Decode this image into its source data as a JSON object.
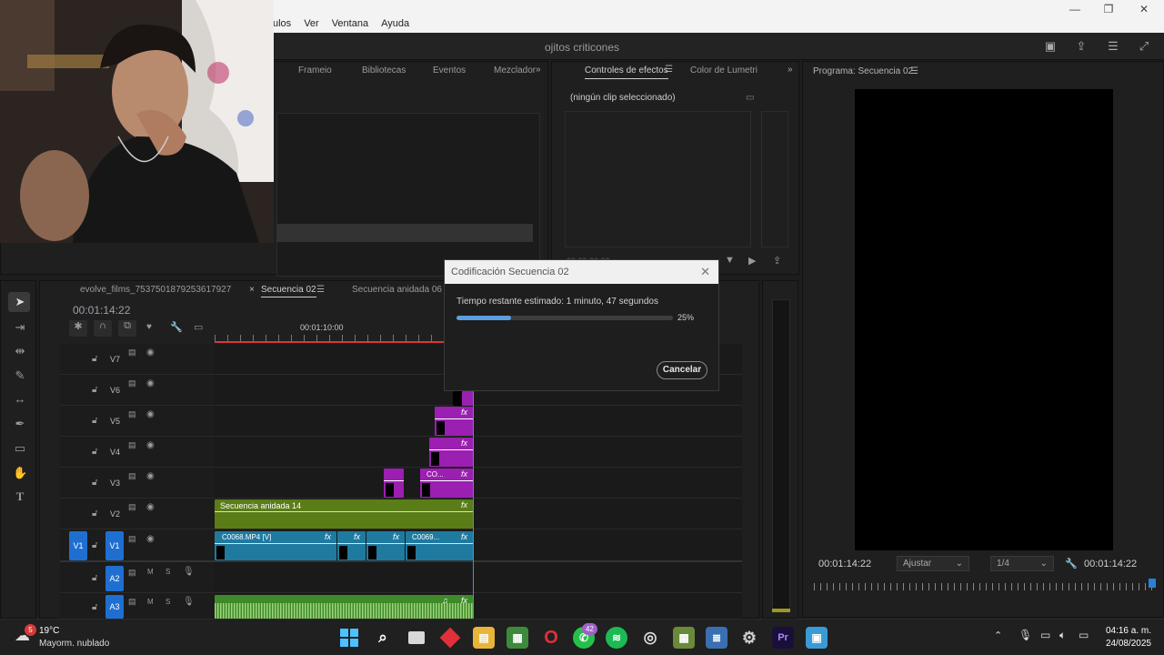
{
  "titlebar": {
    "menu": [
      "ulos",
      "Ver",
      "Ventana",
      "Ayuda"
    ],
    "minimize": "—",
    "maximize": "❐",
    "close": "✕"
  },
  "app": {
    "project_title": "ojitos criticones"
  },
  "source_tabs": [
    "Frameio",
    "Bibliotecas",
    "Eventos",
    "Mezclador"
  ],
  "effects_tabs": {
    "active": "Controles de efectos",
    "second": "Color de Lumetri"
  },
  "effects_panel": {
    "empty_text": "(ningún clip seleccionado)",
    "time": "00:00:00:00"
  },
  "program": {
    "title": "Programa: Secuencia 02",
    "timecode_left": "00:01:14:22",
    "fit": "Ajustar",
    "resolution": "1/4",
    "timecode_right": "00:01:14:22"
  },
  "timeline": {
    "tabs": [
      "evolve_films_7537501879253617927",
      "Secuencia 02",
      "Secuencia anidada 06"
    ],
    "close_glyph": "×",
    "timecode": "00:01:14:22",
    "ruler_label": "00:01:10:00",
    "tracks": [
      {
        "name": "V7"
      },
      {
        "name": "V6"
      },
      {
        "name": "V5"
      },
      {
        "name": "V4"
      },
      {
        "name": "V3"
      },
      {
        "name": "V2"
      },
      {
        "name": "V1"
      },
      {
        "name": "A2"
      },
      {
        "name": "A3"
      }
    ],
    "source_patch": "V1",
    "clips": {
      "v3_label": "CO...",
      "v2_label": "Secuencia anidada 14",
      "v1_a": "C0068.MP4 [V]",
      "v1_b": "C0069...",
      "fx": "fx",
      "m": "M",
      "s": "S"
    }
  },
  "dialog": {
    "title": "Codificación Secuencia 02",
    "remaining": "Tiempo restante estimado: 1 minuto, 47 segundos",
    "progress": 0.25,
    "percent": "25%",
    "cancel": "Cancelar"
  },
  "taskbar": {
    "weather_temp": "19°C",
    "weather_desc": "Mayorm. nublado",
    "weather_badge": "5",
    "whatsapp_badge": "42",
    "time": "04:16 a. m.",
    "date": "24/08/2025"
  },
  "colors": {
    "accent_blue": "#1f6fd1",
    "clip_purple": "#9b1fb0",
    "clip_green": "#5a7d18",
    "clip_teal": "#1f7aa0",
    "audio_green": "#3e8a2a"
  }
}
